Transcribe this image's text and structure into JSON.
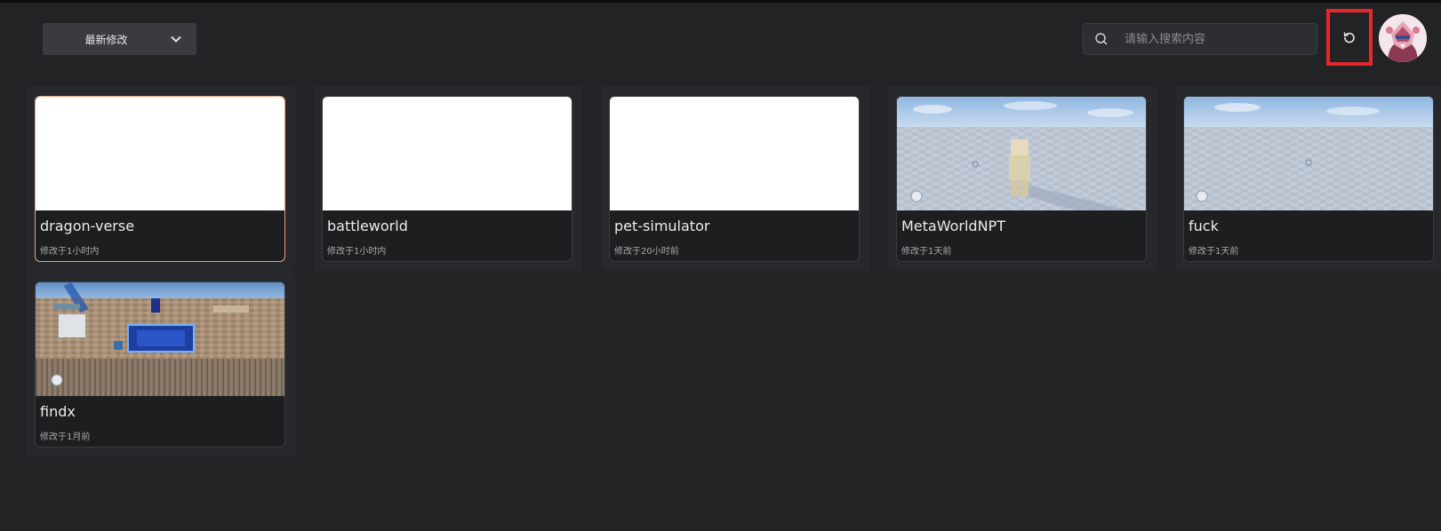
{
  "toolbar": {
    "sort_label": "最新修改",
    "search_placeholder": "请输入搜索内容"
  },
  "projects": [
    {
      "name": "dragon-verse",
      "modified": "修改于1小时内",
      "thumbnail": "blank"
    },
    {
      "name": "battleworld",
      "modified": "修改于1小时内",
      "thumbnail": "blank"
    },
    {
      "name": "pet-simulator",
      "modified": "修改于20小时前",
      "thumbnail": "blank"
    },
    {
      "name": "MetaWorldNPT",
      "modified": "修改于1天前",
      "thumbnail": "scene-sky-character"
    },
    {
      "name": "fuck",
      "modified": "修改于1天前",
      "thumbnail": "scene-sky-empty"
    },
    {
      "name": "findx",
      "modified": "修改于1月前",
      "thumbnail": "scene-arena"
    }
  ],
  "colors": {
    "background": "#222325",
    "card": "#1d1e20",
    "selected_border": "#e6a07c",
    "highlight_box": "#e8262a"
  }
}
